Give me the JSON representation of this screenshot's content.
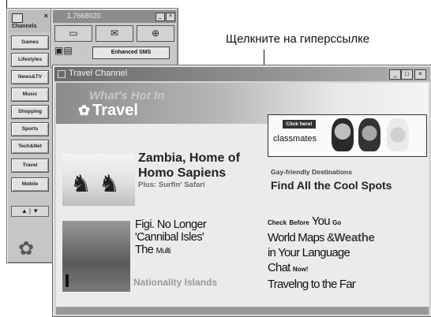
{
  "callout_text": "Щелкните на гиперссылке",
  "channel_bar": {
    "title": "Channels",
    "close": "×",
    "buttons": [
      "Games",
      "Lifestyles",
      "News&TV",
      "Music",
      "Shopping",
      "Sports",
      "Tech&Net",
      "Travel",
      "Mobile"
    ],
    "arrows": "▲ | ▼"
  },
  "msn_bar": {
    "title": "1.7668020",
    "min": "_",
    "close": "×",
    "enhanced": "Enhanced SMS"
  },
  "travel_window": {
    "title": "Travel Channel",
    "min": "_",
    "max": "□",
    "close": "×",
    "banner_hot": "What's Hot In",
    "banner_title": "Travel",
    "ad_click": "Click here!",
    "ad_name": "classmates",
    "zambia_line1": "Zambia, Home of",
    "zambia_line2": "Homo Sapiens",
    "zambia_sub": "Plus: Surfin' Safari",
    "gay_friendly": "Gay-friendly Destinations",
    "find_all": "Find All the Cool Spots",
    "fiji_line1": "Figi. No Longer",
    "fiji_line2": "'Cannibal Isles'",
    "fiji_the": "The",
    "fiji_multi": "Multi",
    "multi_ghost": "Nationality Islands",
    "check": "Check",
    "before": "Before",
    "you": "You",
    "go": "Go",
    "world_maps": "World Maps &",
    "weather": "Weathe",
    "in_language": "in Your Language",
    "chat": "Chat",
    "now": "Now!",
    "traveling": "Travelng to the Far"
  }
}
